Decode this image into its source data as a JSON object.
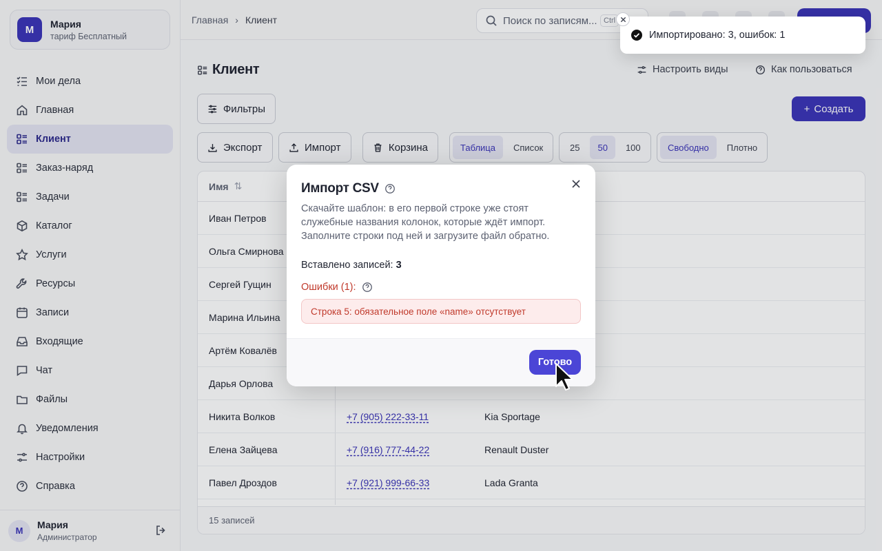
{
  "account": {
    "initial": "М",
    "name": "Мария",
    "plan": "тариф Бесплатный"
  },
  "nav": [
    {
      "label": "Мои дела",
      "icon": "checklist-icon"
    },
    {
      "label": "Главная",
      "icon": "home-icon"
    },
    {
      "label": "Клиент",
      "icon": "list-icon",
      "active": true
    },
    {
      "label": "Заказ-наряд",
      "icon": "list-icon"
    },
    {
      "label": "Задачи",
      "icon": "list-icon"
    },
    {
      "label": "Каталог",
      "icon": "box-icon"
    },
    {
      "label": "Услуги",
      "icon": "star-icon"
    },
    {
      "label": "Ресурсы",
      "icon": "wrench-icon"
    },
    {
      "label": "Записи",
      "icon": "calendar-icon"
    },
    {
      "label": "Входящие",
      "icon": "inbox-icon"
    },
    {
      "label": "Чат",
      "icon": "chat-icon"
    },
    {
      "label": "Файлы",
      "icon": "folder-icon"
    },
    {
      "label": "Уведомления",
      "icon": "bell-icon"
    },
    {
      "label": "Настройки",
      "icon": "sliders-icon"
    },
    {
      "label": "Справка",
      "icon": "help-icon"
    }
  ],
  "user": {
    "initial": "М",
    "name": "Мария",
    "role": "Администратор"
  },
  "breadcrumb": {
    "home": "Главная",
    "current": "Клиент"
  },
  "search": {
    "placeholder": "Поиск по записям...",
    "shortcut": "Ctrl"
  },
  "page": {
    "title": "Клиент",
    "configure_views": "Настроить виды",
    "how_to_use": "Как пользоваться",
    "filters": "Фильтры",
    "create": "Создать",
    "export": "Экспорт",
    "import": "Импорт",
    "trash": "Корзина",
    "view_modes": [
      "Таблица",
      "Список"
    ],
    "page_sizes": [
      "25",
      "50",
      "100"
    ],
    "densities": [
      "Свободно",
      "Плотно"
    ]
  },
  "table": {
    "name_header": "Имя",
    "rows": [
      {
        "name": "Иван Петров",
        "phone": "",
        "car": ""
      },
      {
        "name": "Ольга Смирнова",
        "phone": "",
        "car": ""
      },
      {
        "name": "Сергей Гущин",
        "phone": "",
        "car": ""
      },
      {
        "name": "Марина Ильина",
        "phone": "",
        "car": ""
      },
      {
        "name": "Артём Ковалёв",
        "phone": "",
        "car": ""
      },
      {
        "name": "Дарья Орлова",
        "phone": "",
        "car": ""
      },
      {
        "name": "Никита Волков",
        "phone": "+7 (905) 222-33-11",
        "car": "Kia Sportage"
      },
      {
        "name": "Елена Зайцева",
        "phone": "+7 (916) 777-44-22",
        "car": "Renault Duster"
      },
      {
        "name": "Павел Дроздов",
        "phone": "+7 (921) 999-66-33",
        "car": "Lada Granta"
      }
    ],
    "footer": "15 записей"
  },
  "modal": {
    "title": "Импорт CSV",
    "description": "Скачайте шаблон: в его первой строке уже стоят служебные названия колонок, которые ждёт импорт. Заполните строки под ней и загрузите файл обратно.",
    "inserted_label": "Вставлено записей:",
    "inserted_count": "3",
    "errors_label": "Ошибки (1):",
    "error_line": "Строка 5: обязательное поле «name» отсутствует",
    "done": "Готово"
  },
  "toast": {
    "message": "Импортировано: 3, ошибок: 1"
  }
}
